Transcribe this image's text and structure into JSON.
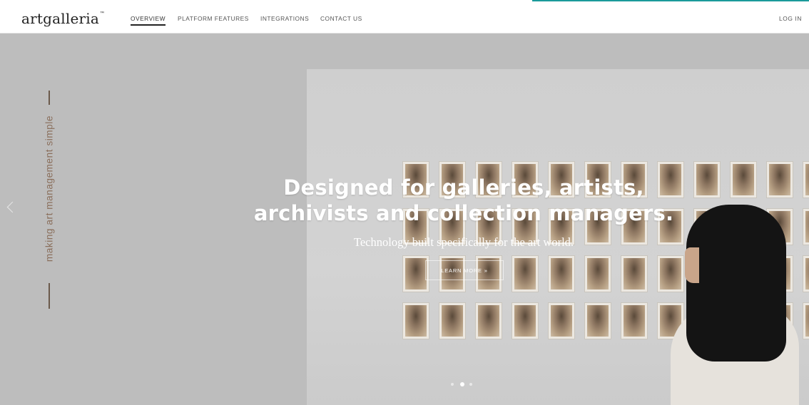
{
  "brand": {
    "logo_text": "artgalleria",
    "logo_mark": "™"
  },
  "nav": {
    "items": [
      {
        "label": "OVERVIEW",
        "active": true
      },
      {
        "label": "PLATFORM FEATURES",
        "active": false
      },
      {
        "label": "INTEGRATIONS",
        "active": false
      },
      {
        "label": "CONTACT US",
        "active": false
      }
    ],
    "login_label": "LOG IN"
  },
  "hero": {
    "tagline": "making art management simple",
    "headline_line1": "Designed for galleries, artists,",
    "headline_line2": "archivists and collection managers.",
    "subheadline": "Technology built specifically for the art world.",
    "cta_label": "LEARN MORE »",
    "slides": {
      "total": 3,
      "active_index": 1
    }
  },
  "colors": {
    "accent_line": "#1a9a9a",
    "tagline_color": "#8a6f5c",
    "hero_background": "#bdbdbd"
  },
  "icons": {
    "prev_arrow": "chevron-left-icon"
  }
}
